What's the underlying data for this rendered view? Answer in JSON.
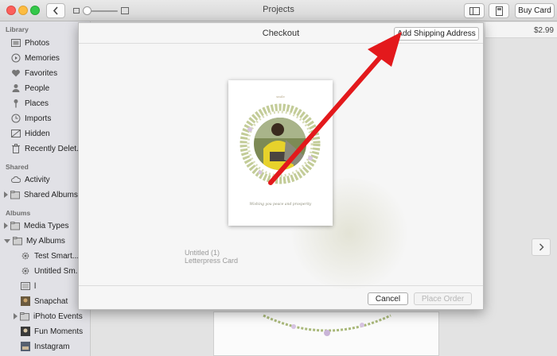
{
  "window": {
    "title": "Projects",
    "buy_button": "Buy Card"
  },
  "sidebar": {
    "library": {
      "header": "Library",
      "items": [
        {
          "label": "Photos",
          "icon": "photos-icon"
        },
        {
          "label": "Memories",
          "icon": "memories-icon"
        },
        {
          "label": "Favorites",
          "icon": "heart-icon"
        },
        {
          "label": "People",
          "icon": "person-icon"
        },
        {
          "label": "Places",
          "icon": "pin-icon"
        },
        {
          "label": "Imports",
          "icon": "clock-icon"
        },
        {
          "label": "Hidden",
          "icon": "hidden-icon"
        },
        {
          "label": "Recently Delet...",
          "icon": "trash-icon"
        }
      ]
    },
    "shared": {
      "header": "Shared",
      "items": [
        {
          "label": "Activity",
          "icon": "cloud-icon"
        },
        {
          "label": "Shared Albums",
          "icon": "folder-icon"
        }
      ]
    },
    "albums": {
      "header": "Albums",
      "items": [
        {
          "label": "Media Types",
          "icon": "folder-icon"
        },
        {
          "label": "My Albums",
          "icon": "folder-icon"
        },
        {
          "label": "Test Smart...",
          "icon": "gear-icon"
        },
        {
          "label": "Untitled Sm...",
          "icon": "gear-icon"
        },
        {
          "label": "l",
          "icon": "album-icon"
        },
        {
          "label": "Snapchat",
          "icon": "thumbnail-icon"
        },
        {
          "label": "iPhoto Events",
          "icon": "folder-icon"
        },
        {
          "label": "Fun Moments",
          "icon": "thumbnail-icon"
        },
        {
          "label": "Instagram",
          "icon": "thumbnail-icon"
        }
      ]
    }
  },
  "main": {
    "price": "$2.99"
  },
  "checkout": {
    "title": "Checkout",
    "add_shipping": "Add Shipping Address",
    "card_top_text": "smile",
    "card_caption": "Wishing you peace and prosperity",
    "project_name": "Untitled (1)",
    "project_type": "Letterpress Card",
    "cancel": "Cancel",
    "place_order": "Place Order"
  },
  "colors": {
    "annotation_arrow": "#e3191c",
    "disabled_text": "#b6b6b6"
  }
}
